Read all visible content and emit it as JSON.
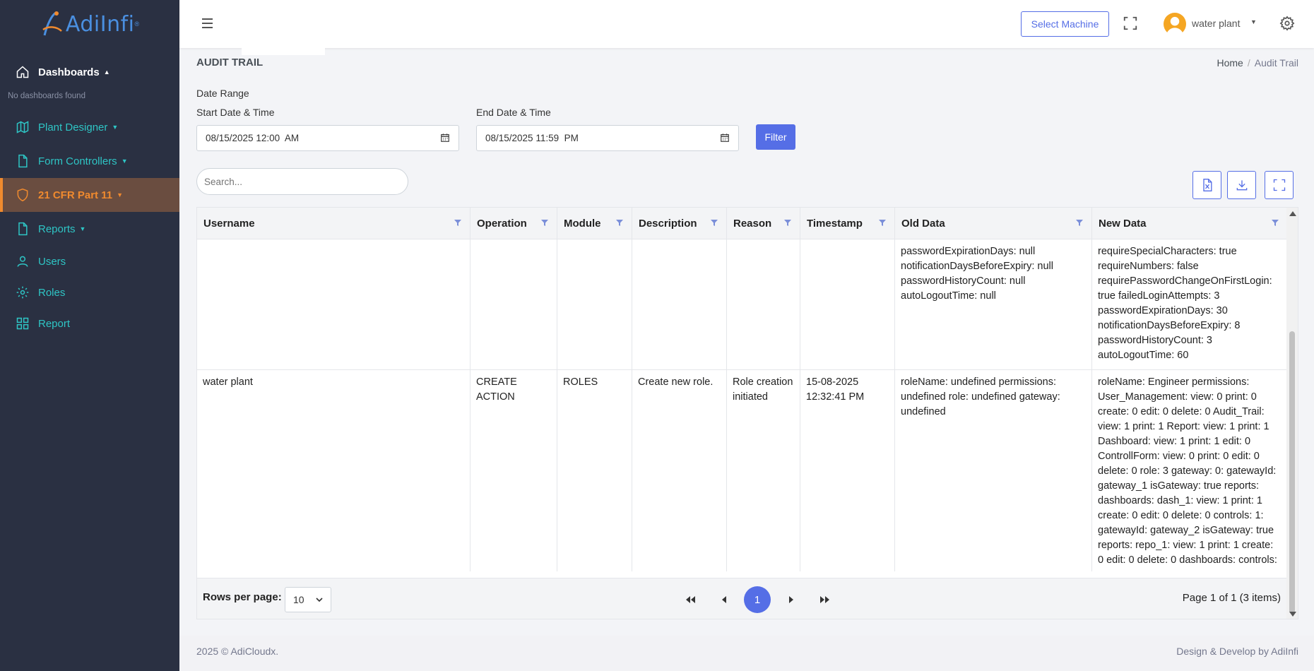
{
  "brand": {
    "name": "AdiInfi",
    "reg": "®"
  },
  "sidebar": {
    "dashboards_label": "Dashboards",
    "no_dashboards": "No dashboards found",
    "items": [
      {
        "label": "Plant Designer",
        "icon": "map-icon"
      },
      {
        "label": "Form Controllers",
        "icon": "file-icon"
      },
      {
        "label": "21 CFR Part 11",
        "icon": "shield-icon"
      },
      {
        "label": "Reports",
        "icon": "file-icon"
      },
      {
        "label": "Users",
        "icon": "user-icon"
      },
      {
        "label": "Roles",
        "icon": "gear-icon"
      },
      {
        "label": "Report",
        "icon": "grid-icon"
      }
    ]
  },
  "topbar": {
    "select_machine": "Select Machine",
    "user_name": "water plant"
  },
  "page": {
    "title": "AUDIT TRAIL",
    "breadcrumb_home": "Home",
    "breadcrumb_sep": "/",
    "breadcrumb_current": "Audit Trail"
  },
  "filters": {
    "date_range_label": "Date Range",
    "start_label": "Start Date & Time",
    "start_value": "08/15/2025 12:00  AM",
    "end_label": "End Date & Time",
    "end_value": "08/15/2025 11:59  PM",
    "filter_button": "Filter",
    "search_placeholder": "Search..."
  },
  "table": {
    "columns": [
      "Username",
      "Operation",
      "Module",
      "Description",
      "Reason",
      "Timestamp",
      "Old Data",
      "New Data"
    ],
    "rows": [
      {
        "username": "",
        "operation": "",
        "module": "",
        "description": "",
        "reason": "",
        "timestamp": "",
        "old_data": "passwordExpirationDays: null notificationDaysBeforeExpiry: null passwordHistoryCount: null autoLogoutTime: null",
        "new_data": "requireSpecialCharacters: true requireNumbers: false requirePasswordChangeOnFirstLogin: true failedLoginAttempts: 3 passwordExpirationDays: 30 notificationDaysBeforeExpiry: 8 passwordHistoryCount: 3 autoLogoutTime: 60"
      },
      {
        "username": "water plant",
        "operation": "CREATE ACTION",
        "module": "ROLES",
        "description": "Create new role.",
        "reason": "Role creation initiated",
        "timestamp": "15-08-2025 12:32:41 PM",
        "old_data": "roleName: undefined permissions: undefined role: undefined gateway: undefined",
        "new_data": "roleName: Engineer permissions: User_Management: view: 0 print: 0 create: 0 edit: 0 delete: 0 Audit_Trail: view: 1 print: 1 Report: view: 1 print: 1 Dashboard: view: 1 print: 1 edit: 0 ControllForm: view: 0 print: 0 edit: 0 delete: 0 role: 3 gateway: 0: gatewayId: gateway_1 isGateway: true reports: dashboards: dash_1: view: 1 print: 1 create: 0 edit: 0 delete: 0 controls: 1: gatewayId: gateway_2 isGateway: true reports: repo_1: view: 1 print: 1 create: 0 edit: 0 delete: 0 dashboards: controls:"
      }
    ]
  },
  "pager": {
    "rows_per_page_label": "Rows per page:",
    "rows_per_page_value": "10",
    "current_page": "1",
    "page_info": "Page 1 of 1 (3 items)"
  },
  "footer": {
    "left": "2025 © AdiCloudx.",
    "right": "Design & Develop by AdiInfi"
  },
  "colors": {
    "sidebar_bg": "#2a3042",
    "accent": "#556ee6",
    "nav_text": "#2ec5c5",
    "active_text": "#f08a2e",
    "active_bg": "#6a4d40"
  }
}
